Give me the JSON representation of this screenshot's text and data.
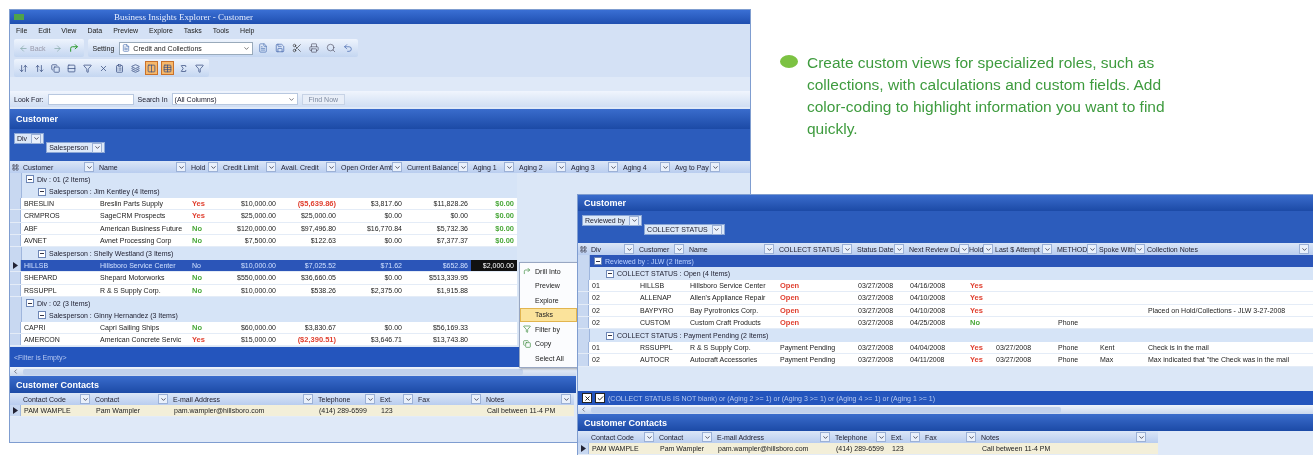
{
  "callout": {
    "text": "Create custom views for specialized roles, such as collections, with calculations and custom fields. Add color-coding to highlight information you want to find quickly."
  },
  "explorer": {
    "title": "Business Insights Explorer - Customer",
    "menu": [
      "File",
      "Edit",
      "View",
      "Data",
      "Preview",
      "Explore",
      "Tasks",
      "Tools",
      "Help"
    ],
    "toolbar": {
      "back": "Back",
      "setting": "Setting",
      "view": "Credit and Collections"
    },
    "tool_buttons": [
      {
        "pressed": false
      },
      {
        "pressed": false
      },
      {
        "pressed": false
      },
      {
        "pressed": false
      },
      {
        "pressed": false
      },
      {
        "pressed": false
      },
      {
        "pressed": false
      },
      {
        "pressed": false
      },
      {
        "pressed": true
      },
      {
        "pressed": true
      },
      {
        "pressed": false
      },
      {
        "pressed": false
      }
    ],
    "search": {
      "label": "Look For:",
      "in_label": "Search In",
      "in_value": "(All Columns)",
      "find": "Find Now"
    },
    "panel": {
      "title": "Customer",
      "group_by": [
        "Div",
        "Salesperson"
      ],
      "columns": [
        "Customer",
        "Name",
        "Hold",
        "Credit Limit",
        "Avail. Credit",
        "Open Order Amt",
        "Current Balance",
        "Aging 1",
        "Aging 2",
        "Aging 3",
        "Aging 4",
        "Avg to Pay"
      ],
      "groups": [
        {
          "label": "Div : 01 (2 Items)",
          "expanded": true,
          "selected": false,
          "children": [
            {
              "label": "Salesperson : Jim Kentley (4 Items)",
              "expanded": true,
              "selected": false,
              "children": [
                {
                  "selected": false,
                  "cells": [
                    "BRESLIN",
                    "Breslin Parts Supply",
                    {
                      "text": "Yes",
                      "color": "#e04030"
                    },
                    "$10,000.00",
                    {
                      "text": "($5,639.86)",
                      "color": "#e04030"
                    },
                    "$3,817.60",
                    "$11,828.26",
                    {
                      "text": "$0.00",
                      "color": "#4aa83a"
                    }
                  ]
                },
                {
                  "selected": false,
                  "cells": [
                    "CRMPROS",
                    "SageCRM Prospects",
                    {
                      "text": "Yes",
                      "color": "#e04030"
                    },
                    "$25,000.00",
                    "$25,000.00",
                    "$0.00",
                    "$0.00",
                    {
                      "text": "$0.00",
                      "color": "#4aa83a"
                    }
                  ]
                },
                {
                  "selected": false,
                  "cells": [
                    "ABF",
                    "American Business Future",
                    {
                      "text": "No",
                      "color": "#4aa83a"
                    },
                    "$120,000.00",
                    "$97,496.80",
                    "$16,770.84",
                    "$5,732.36",
                    {
                      "text": "$0.00",
                      "color": "#4aa83a"
                    }
                  ]
                },
                {
                  "selected": false,
                  "cells": [
                    "AVNET",
                    "Avnet Processing Corp",
                    {
                      "text": "No",
                      "color": "#4aa83a"
                    },
                    "$7,500.00",
                    "$122.63",
                    "$0.00",
                    "$7,377.37",
                    {
                      "text": "$0.00",
                      "color": "#4aa83a"
                    }
                  ]
                }
              ]
            },
            {
              "label": "Salesperson : Shelly Westland (3 Items)",
              "expanded": true,
              "selected": false,
              "children": [
                {
                  "selected": true,
                  "cells": [
                    "HILLSB",
                    "Hillsboro Service Center",
                    "No",
                    "$10,000.00",
                    "$7,025.52",
                    "$71.62",
                    "$652.86",
                    {
                      "text": "$2,000.00",
                      "highlighted": true
                    }
                  ]
                },
                {
                  "selected": false,
                  "cells": [
                    "SHEPARD",
                    "Shepard Motorworks",
                    {
                      "text": "No",
                      "color": "#4aa83a"
                    },
                    "$550,000.00",
                    "$36,660.05",
                    "$0.00",
                    "$513,339.95"
                  ]
                },
                {
                  "selected": false,
                  "cells": [
                    "RSSUPPL",
                    "R & S Supply Corp.",
                    {
                      "text": "No",
                      "color": "#4aa83a"
                    },
                    "$10,000.00",
                    "$538.26",
                    "$2,375.00",
                    "$1,915.88"
                  ]
                }
              ]
            }
          ]
        },
        {
          "label": "Div : 02 (3 Items)",
          "expanded": true,
          "selected": false,
          "children": [
            {
              "label": "Salesperson : Ginny Hernandez (3 Items)",
              "expanded": true,
              "selected": false,
              "children": [
                {
                  "selected": false,
                  "cells": [
                    "CAPRI",
                    "Capri Sailing Ships",
                    {
                      "text": "No",
                      "color": "#4aa83a"
                    },
                    "$60,000.00",
                    "$3,830.67",
                    "$0.00",
                    "$56,169.33"
                  ]
                },
                {
                  "selected": false,
                  "cells": [
                    "AMERCON",
                    "American Concrete Servic",
                    {
                      "text": "Yes",
                      "color": "#e04030"
                    },
                    "$15,000.00",
                    {
                      "text": "($2,390.51)",
                      "color": "#e04030"
                    },
                    "$3,646.71",
                    "$13,743.80"
                  ]
                }
              ]
            }
          ]
        }
      ],
      "filter": "<Filter is Empty>",
      "filter_enabled": false
    },
    "context_menu": [
      {
        "label": "Drill Into",
        "selected": false
      },
      {
        "label": "Preview",
        "selected": false
      },
      {
        "label": "Explore",
        "selected": false
      },
      {
        "label": "Tasks",
        "selected": true
      },
      {
        "label": "Filter by",
        "selected": false
      },
      {
        "label": "Copy",
        "selected": false
      },
      {
        "label": "Select All",
        "selected": false
      }
    ],
    "contacts": {
      "title": "Customer Contacts",
      "columns": [
        "Contact Code",
        "Contact",
        "E-mail Address",
        "Telephone",
        "Ext.",
        "Fax",
        "Notes"
      ],
      "rows": [
        {
          "selected": false,
          "cells": [
            "PAM WAMPLE",
            "Pam Wampler",
            "pam.wampler@hillsboro.com",
            "(414) 289-6599",
            "123",
            "",
            "Call between 11-4 PM"
          ]
        }
      ]
    }
  },
  "collections": {
    "panel": {
      "title": "Customer",
      "group_by": [
        "Reviewed by",
        "COLLECT STATUS"
      ],
      "columns": [
        "Div",
        "Customer",
        "Name",
        "COLLECT STATUS",
        "Status Date",
        "Next Review Du",
        "Hold",
        "Last $ Attempt",
        "METHOD",
        "Spoke With",
        "Collection Notes"
      ],
      "groups": [
        {
          "label": "Reviewed by : JLW (2 Items)",
          "expanded": true,
          "selected": true,
          "children": [
            {
              "label": "COLLECT STATUS : Open (4 Items)",
              "expanded": true,
              "selected": false,
              "children": [
                {
                  "selected": false,
                  "cells": [
                    "01",
                    "HILLSB",
                    "Hillsboro Service Center",
                    {
                      "text": "Open",
                      "color": "#e04030"
                    },
                    "03/27/2008",
                    "04/16/2008",
                    {
                      "text": "Yes",
                      "color": "#e04030"
                    }
                  ]
                },
                {
                  "selected": false,
                  "cells": [
                    "02",
                    "ALLENAP",
                    "Allen's Appliance Repair",
                    {
                      "text": "Open",
                      "color": "#e04030"
                    },
                    "03/27/2008",
                    "04/10/2008",
                    {
                      "text": "Yes",
                      "color": "#e04030"
                    }
                  ]
                },
                {
                  "selected": false,
                  "cells": [
                    "02",
                    "BAYPYRO",
                    "Bay Pyrotronics Corp.",
                    {
                      "text": "Open",
                      "color": "#e04030"
                    },
                    "03/27/2008",
                    "04/10/2008",
                    {
                      "text": "Yes",
                      "color": "#e04030"
                    },
                    "",
                    "",
                    "",
                    "Placed on Hold/Collections - JLW 3-27-2008"
                  ]
                },
                {
                  "selected": false,
                  "cells": [
                    "02",
                    "CUSTOM",
                    "Custom Craft Products",
                    {
                      "text": "Open",
                      "color": "#e04030"
                    },
                    "03/27/2008",
                    "04/25/2008",
                    {
                      "text": "No",
                      "color": "#4aa83a"
                    },
                    "",
                    "Phone"
                  ]
                }
              ]
            },
            {
              "label": "COLLECT STATUS : Payment Pending (2 Items)",
              "expanded": true,
              "selected": false,
              "children": [
                {
                  "selected": false,
                  "cells": [
                    "01",
                    "RSSUPPL",
                    "R & S Supply Corp.",
                    "Payment Pending",
                    "03/27/2008",
                    "04/04/2008",
                    {
                      "text": "Yes",
                      "color": "#e04030"
                    },
                    "03/27/2008",
                    "Phone",
                    "Kent",
                    "Check is in the mail"
                  ]
                },
                {
                  "selected": false,
                  "cells": [
                    "02",
                    "AUTOCR",
                    "Autocraft Accessories",
                    "Payment Pending",
                    "03/27/2008",
                    "04/11/2008",
                    {
                      "text": "Yes",
                      "color": "#e04030"
                    },
                    "03/27/2008",
                    "Phone",
                    "Max",
                    "Max indicated that \"the Check was in the mail"
                  ]
                }
              ]
            }
          ]
        }
      ],
      "filter": "(COLLECT STATUS IS NOT blank) or (Aging 2 >= 1) or (Aging 3 >= 1) or (Aging 4 >= 1) or (Aging 1 >= 1)",
      "filter_enabled": true
    },
    "contacts": {
      "title": "Customer Contacts",
      "columns": [
        "Contact Code",
        "Contact",
        "E-mail Address",
        "Telephone",
        "Ext.",
        "Fax",
        "Notes"
      ],
      "rows": [
        {
          "selected": false,
          "cells": [
            "PAM WAMPLE",
            "Pam Wampler",
            "pam.wampler@hillsboro.com",
            "(414) 289-6599",
            "123",
            "",
            "Call between 11-4 PM"
          ]
        }
      ]
    }
  }
}
